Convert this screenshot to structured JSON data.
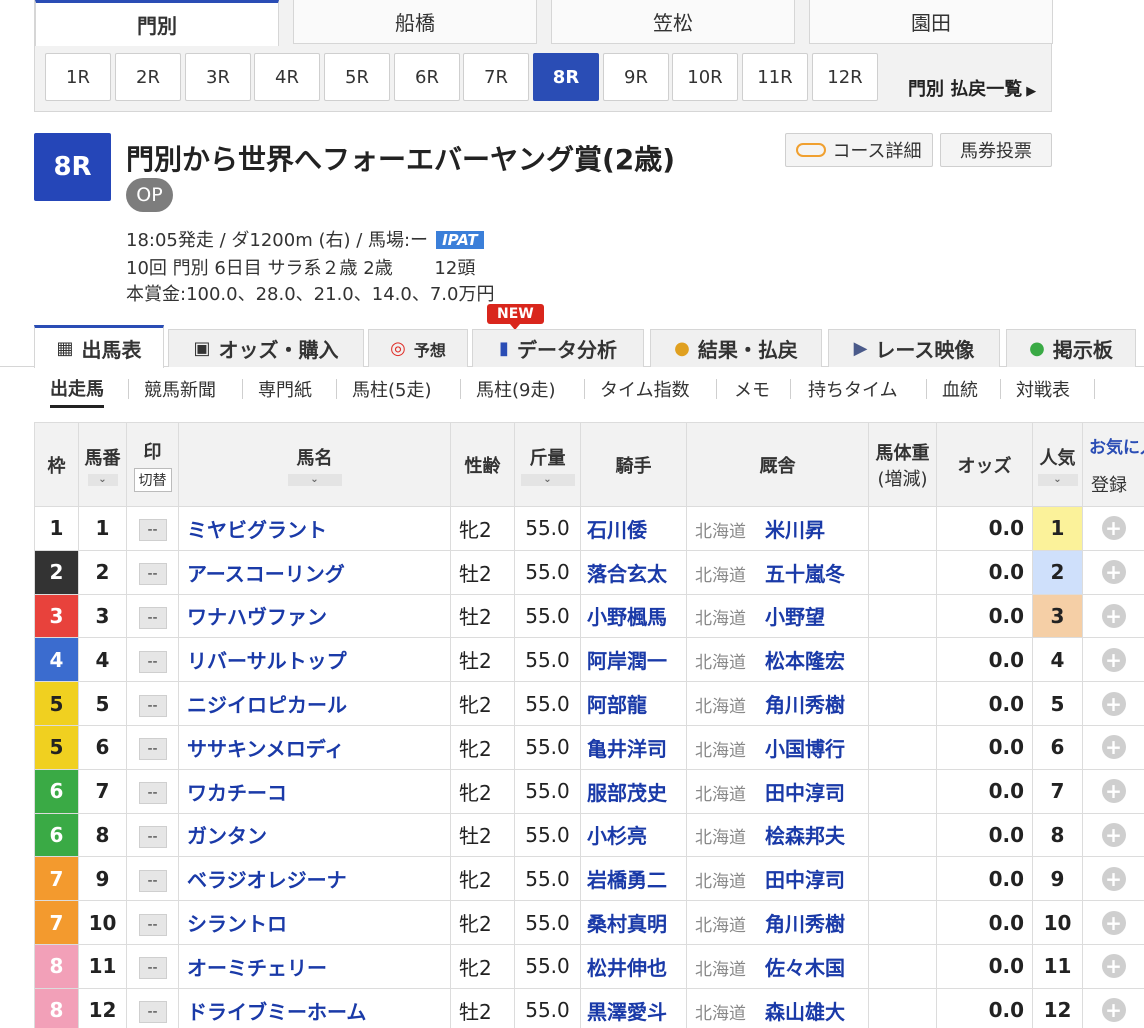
{
  "venues": [
    "門別",
    "船橋",
    "笠松",
    "園田"
  ],
  "races": [
    "1R",
    "2R",
    "3R",
    "4R",
    "5R",
    "6R",
    "7R",
    "8R",
    "9R",
    "10R",
    "11R",
    "12R"
  ],
  "payout_link": "門別 払戻一覧",
  "race": {
    "number": "8R",
    "title": "門別から世界へフォーエバーヤング賞(2歳)",
    "grade": "OP",
    "course_detail": "コース詳細",
    "bet": "馬券投票",
    "info1": "18:05発走 / ダ1200m (右) / 馬場:ー",
    "ipat": "IPAT",
    "info2": "10回 門別 6日目 サラ系２歳 2歳　　 12頭",
    "info3": "本賞金:100.0、28.0、21.0、14.0、7.0万円"
  },
  "main_tabs": [
    "出馬表",
    "オッズ・購入",
    "予想",
    "データ分析",
    "結果・払戻",
    "レース映像",
    "掲示板"
  ],
  "new_badge": "NEW",
  "sub_tabs": [
    "出走馬",
    "競馬新聞",
    "専門紙",
    "馬柱(5走)",
    "馬柱(9走)",
    "タイム指数",
    "メモ",
    "持ちタイム",
    "血統",
    "対戦表"
  ],
  "table": {
    "headers": {
      "waku": "枠",
      "num": "馬番",
      "mark": "印",
      "switch": "切替",
      "horse": "馬名",
      "sex_age": "性齢",
      "weight": "斤量",
      "jockey": "騎手",
      "stable": "厩舎",
      "body_weight": "馬体重",
      "body_change": "(増減)",
      "odds": "オッズ",
      "popularity": "人気",
      "fav": "お気に入り",
      "register": "登録"
    },
    "rows": [
      {
        "waku": "1",
        "num": "1",
        "mark": "--",
        "horse": "ミヤビグラント",
        "sex": "牝2",
        "weight": "55.0",
        "jockey": "石川倭",
        "region": "北海道",
        "trainer": "米川昇",
        "odds": "0.0",
        "pop": "1"
      },
      {
        "waku": "2",
        "num": "2",
        "mark": "--",
        "horse": "アースコーリング",
        "sex": "牡2",
        "weight": "55.0",
        "jockey": "落合玄太",
        "region": "北海道",
        "trainer": "五十嵐冬",
        "odds": "0.0",
        "pop": "2"
      },
      {
        "waku": "3",
        "num": "3",
        "mark": "--",
        "horse": "ワナハヴファン",
        "sex": "牡2",
        "weight": "55.0",
        "jockey": "小野楓馬",
        "region": "北海道",
        "trainer": "小野望",
        "odds": "0.0",
        "pop": "3"
      },
      {
        "waku": "4",
        "num": "4",
        "mark": "--",
        "horse": "リバーサルトップ",
        "sex": "牡2",
        "weight": "55.0",
        "jockey": "阿岸潤一",
        "region": "北海道",
        "trainer": "松本隆宏",
        "odds": "0.0",
        "pop": "4"
      },
      {
        "waku": "5",
        "num": "5",
        "mark": "--",
        "horse": "ニジイロピカール",
        "sex": "牝2",
        "weight": "55.0",
        "jockey": "阿部龍",
        "region": "北海道",
        "trainer": "角川秀樹",
        "odds": "0.0",
        "pop": "5"
      },
      {
        "waku": "5",
        "num": "6",
        "mark": "--",
        "horse": "ササキンメロディ",
        "sex": "牝2",
        "weight": "55.0",
        "jockey": "亀井洋司",
        "region": "北海道",
        "trainer": "小国博行",
        "odds": "0.0",
        "pop": "6"
      },
      {
        "waku": "6",
        "num": "7",
        "mark": "--",
        "horse": "ワカチーコ",
        "sex": "牝2",
        "weight": "55.0",
        "jockey": "服部茂史",
        "region": "北海道",
        "trainer": "田中淳司",
        "odds": "0.0",
        "pop": "7"
      },
      {
        "waku": "6",
        "num": "8",
        "mark": "--",
        "horse": "ガンタン",
        "sex": "牡2",
        "weight": "55.0",
        "jockey": "小杉亮",
        "region": "北海道",
        "trainer": "桧森邦夫",
        "odds": "0.0",
        "pop": "8"
      },
      {
        "waku": "7",
        "num": "9",
        "mark": "--",
        "horse": "ベラジオレジーナ",
        "sex": "牝2",
        "weight": "55.0",
        "jockey": "岩橋勇二",
        "region": "北海道",
        "trainer": "田中淳司",
        "odds": "0.0",
        "pop": "9"
      },
      {
        "waku": "7",
        "num": "10",
        "mark": "--",
        "horse": "シラントロ",
        "sex": "牝2",
        "weight": "55.0",
        "jockey": "桑村真明",
        "region": "北海道",
        "trainer": "角川秀樹",
        "odds": "0.0",
        "pop": "10"
      },
      {
        "waku": "8",
        "num": "11",
        "mark": "--",
        "horse": "オーミチェリー",
        "sex": "牝2",
        "weight": "55.0",
        "jockey": "松井伸也",
        "region": "北海道",
        "trainer": "佐々木国",
        "odds": "0.0",
        "pop": "11"
      },
      {
        "waku": "8",
        "num": "12",
        "mark": "--",
        "horse": "ドライブミーホーム",
        "sex": "牡2",
        "weight": "55.0",
        "jockey": "黒澤愛斗",
        "region": "北海道",
        "trainer": "森山雄大",
        "odds": "0.0",
        "pop": "12"
      }
    ]
  },
  "colors": {
    "accent": "#2a4db5",
    "waku": {
      "1": "#ffffff",
      "2": "#333333",
      "3": "#e8423c",
      "4": "#3b6ccf",
      "5": "#f0d020",
      "6": "#3aaa45",
      "7": "#f39a2e",
      "8": "#f2a0b8"
    },
    "pop1": "#fbf29a",
    "pop2": "#cfe0fb",
    "pop3": "#f5cfa6"
  }
}
